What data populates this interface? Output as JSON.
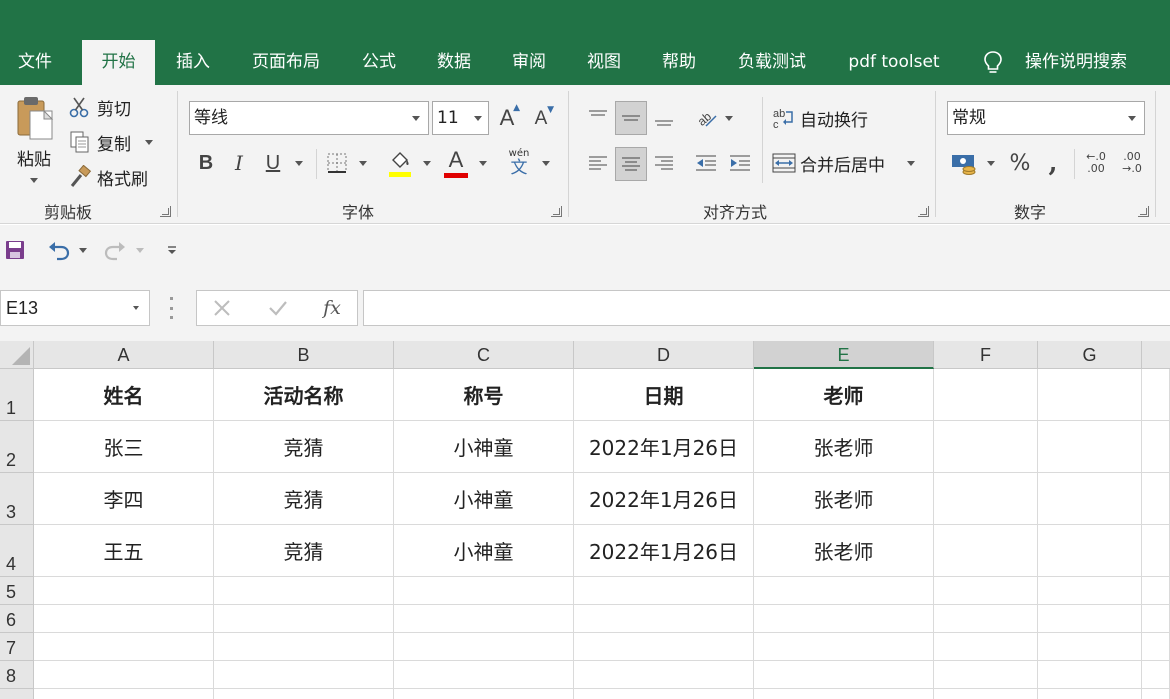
{
  "tabs": [
    "文件",
    "开始",
    "插入",
    "页面布局",
    "公式",
    "数据",
    "审阅",
    "视图",
    "帮助",
    "负载测试",
    "pdf toolset"
  ],
  "active_tab": "开始",
  "tell_me": "操作说明搜索",
  "clipboard": {
    "paste": "粘贴",
    "cut": "剪切",
    "copy": "复制",
    "format_painter": "格式刷",
    "group_label": "剪贴板"
  },
  "font": {
    "name": "等线",
    "size": "11",
    "bold": "B",
    "italic": "I",
    "underline": "U",
    "phonetic_top": "wén",
    "phonetic_bottom": "文",
    "group_label": "字体",
    "highlight_color": "#ffff00",
    "font_color": "#e00000"
  },
  "alignment": {
    "wrap_text": "自动换行",
    "merge_center": "合并后居中",
    "group_label": "对齐方式"
  },
  "number": {
    "format": "常规",
    "percent": "%",
    "comma": ",",
    "inc_decimal_top": "←.0",
    "inc_decimal_bottom": ".00",
    "dec_decimal_top": ".00",
    "dec_decimal_bottom": "→.0",
    "group_label": "数字"
  },
  "formula_bar": {
    "name_box": "E13",
    "fx": "fx",
    "value": ""
  },
  "columns": [
    "A",
    "B",
    "C",
    "D",
    "E",
    "F",
    "G"
  ],
  "selected_column": "E",
  "rows": [
    "1",
    "2",
    "3",
    "4",
    "5",
    "6",
    "7",
    "8"
  ],
  "table": {
    "headers": [
      "姓名",
      "活动名称",
      "称号",
      "日期",
      "老师"
    ],
    "rows": [
      [
        "张三",
        "竞猜",
        "小神童",
        "2022年1月26日",
        "张老师"
      ],
      [
        "李四",
        "竞猜",
        "小神童",
        "2022年1月26日",
        "张老师"
      ],
      [
        "王五",
        "竞猜",
        "小神童",
        "2022年1月26日",
        "张老师"
      ]
    ]
  },
  "colors": {
    "brand_green": "#217346",
    "ribbon_bg": "#f3f3f3"
  }
}
